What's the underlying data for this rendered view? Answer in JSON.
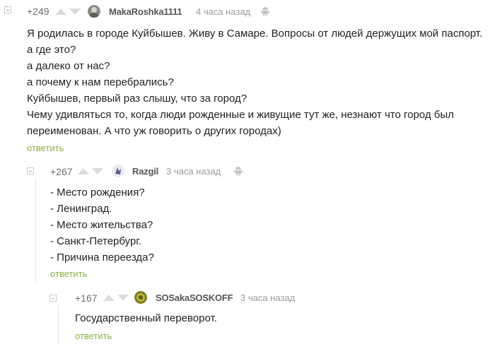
{
  "comments": [
    {
      "rating": "+249",
      "author": "MakaRoshka1111",
      "time": "4 часа назад",
      "lines": [
        "Я родилась в городе Куйбышев. Живу в Самаре. Вопросы от людей держущих мой паспорт.",
        "а где это?",
        "а далеко от нас?",
        "а почему к нам перебрались?",
        "Куйбышев, первый раз слышу, что за город?",
        "Чему удивляться то, когда люди рожденные и живущие тут же, незнают что город был",
        "переименован. А что уж говорить о других городах)"
      ],
      "reply_label": "ответить"
    },
    {
      "rating": "+267",
      "author": "Razgil",
      "time": "3 часа назад",
      "lines": [
        "- Место рождения?",
        "- Ленинград.",
        "- Место жительства?",
        "- Санкт-Петербург.",
        "- Причина переезда?"
      ],
      "reply_label": "ответить"
    },
    {
      "rating": "+167",
      "author": "SOSakaSOSKOFF",
      "time": "3 часа назад",
      "lines": [
        "Государственный переворот."
      ],
      "reply_label": "ответить"
    }
  ],
  "colors": {
    "reply_link": "#8bb04b",
    "vote_arrow": "#dcdcdc",
    "rating_text": "#6f6f6f",
    "time_text": "#9a9a9a"
  },
  "icons": {
    "collapse": "minus-square-icon",
    "vote_up": "arrow-up-icon",
    "vote_down": "arrow-down-icon",
    "platform": "android-icon"
  }
}
